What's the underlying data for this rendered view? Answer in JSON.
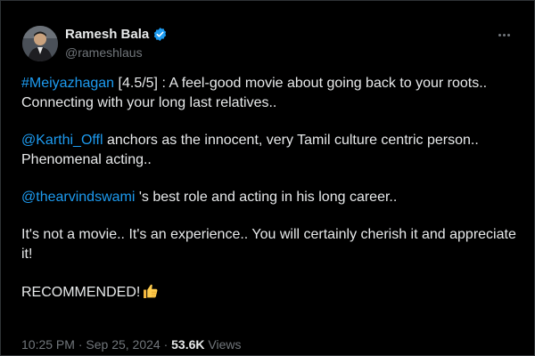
{
  "tweet": {
    "author": {
      "display_name": "Ramesh Bala",
      "handle": "@rameshlaus",
      "verified": true,
      "avatar_icon": "profile-photo"
    },
    "more_icon": "more-horizontal-icon",
    "paragraphs": [
      {
        "link": "#Meiyazhagan",
        "text": " [4.5/5] : A feel-good movie about going back to your roots.. Connecting with your long last relatives.."
      },
      {
        "link": "@Karthi_Offl",
        "text": " anchors as the innocent, very Tamil culture centric person.. Phenomenal acting.."
      },
      {
        "link": "@thearvindswami",
        "text": " 's best role and acting in his long career.."
      },
      {
        "text": "It's not a movie.. It's an experience.. You will certainly cherish it and appreciate it!"
      },
      {
        "text": "RECOMMENDED!",
        "emoji_icon": "thumbs-up-icon"
      }
    ],
    "meta": {
      "time": "10:25 PM",
      "separator": "·",
      "date": "Sep 25, 2024",
      "views_count": "53.6K",
      "views_label": "Views"
    }
  },
  "colors": {
    "background": "#000000",
    "text": "#e7e9ea",
    "muted": "#71767b",
    "link": "#1d9bf0",
    "verified": "#1d9bf0"
  }
}
